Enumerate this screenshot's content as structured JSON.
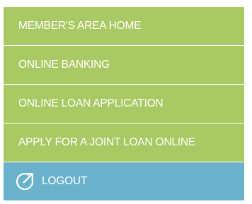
{
  "menu": {
    "items": [
      {
        "label": "MEMBER'S AREA HOME"
      },
      {
        "label": "ONLINE BANKING"
      },
      {
        "label": "ONLINE LOAN APPLICATION"
      },
      {
        "label": "APPLY FOR A JOINT LOAN ONLINE"
      }
    ],
    "logout": {
      "label": "LOGOUT",
      "icon": "logout-icon"
    }
  },
  "colors": {
    "item_background": "#a8c963",
    "logout_background": "#6ab2cc",
    "text": "#ffffff"
  }
}
